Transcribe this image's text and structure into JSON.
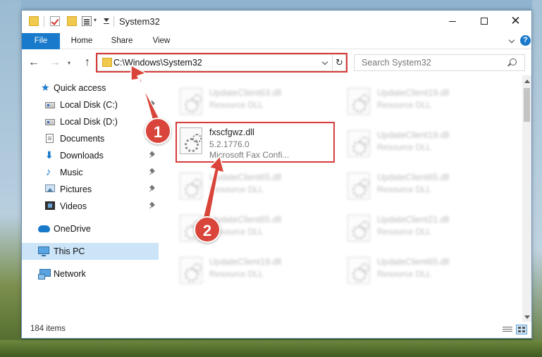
{
  "window": {
    "title": "System32"
  },
  "ribbon": {
    "tabs": [
      "File",
      "Home",
      "Share",
      "View"
    ],
    "help_label": "?"
  },
  "address": {
    "path": "C:\\Windows\\System32"
  },
  "search": {
    "placeholder": "Search System32"
  },
  "sidebar": {
    "items": [
      {
        "label": "Quick access",
        "icon": "star-icon"
      },
      {
        "label": "Local Disk (C:)",
        "icon": "drive-icon",
        "pinned": true
      },
      {
        "label": "Local Disk (D:)",
        "icon": "drive-icon",
        "pinned": false
      },
      {
        "label": "Documents",
        "icon": "documents-icon",
        "pinned": true
      },
      {
        "label": "Downloads",
        "icon": "download-icon",
        "pinned": true
      },
      {
        "label": "Music",
        "icon": "music-icon",
        "pinned": true
      },
      {
        "label": "Pictures",
        "icon": "pictures-icon",
        "pinned": true
      },
      {
        "label": "Videos",
        "icon": "videos-icon",
        "pinned": true
      },
      {
        "label": "OneDrive",
        "icon": "cloud-icon"
      },
      {
        "label": "This PC",
        "icon": "computer-icon",
        "selected": true
      },
      {
        "label": "Network",
        "icon": "network-icon"
      }
    ]
  },
  "files": {
    "featured": {
      "name": "fxscfgwz.dll",
      "version": "5.2.1776.0",
      "description": "Microsoft Fax Confi..."
    },
    "blurred": [
      {
        "name": "UpdateClient63.dll",
        "desc": "Resource DLL"
      },
      {
        "name": "UpdateClient19.dll",
        "desc": "Resource DLL"
      },
      {
        "name": "UpdateClient19.dll",
        "desc": "Resource DLL"
      },
      {
        "name": "UpdateClient65.dll",
        "desc": "Resource DLL"
      },
      {
        "name": "UpdateClient65.dll",
        "desc": "Resource DLL"
      },
      {
        "name": "UpdateClient65.dll",
        "desc": "Resource DLL"
      },
      {
        "name": "UpdateClient21.dll",
        "desc": "Resource DLL"
      },
      {
        "name": "UpdateClient19.dll",
        "desc": "Resource DLL"
      },
      {
        "name": "UpdateClient65.dll",
        "desc": "Resource DLL"
      }
    ]
  },
  "status": {
    "item_count": "184 items"
  },
  "annotations": {
    "step1": "1",
    "step2": "2",
    "highlight_color": "#d83c3c"
  },
  "colors": {
    "accent": "#1979ca",
    "selection": "#cce4f7"
  }
}
